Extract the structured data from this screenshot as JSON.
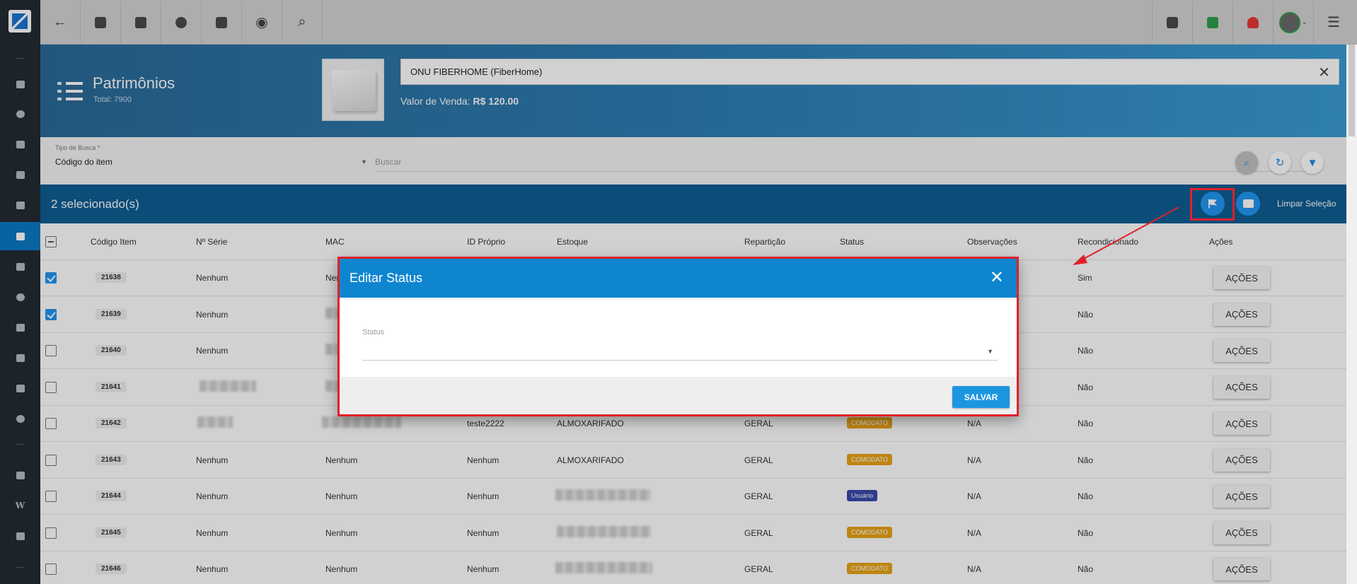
{
  "sidebar": {
    "icons": [
      "dashboard-icon",
      "pie-chart-icon",
      "contact-card-icon",
      "board-icon",
      "calendar-icon",
      "box-icon",
      "money-icon",
      "location-icon",
      "list-icon",
      "server-icon",
      "document-icon",
      "gear-icon",
      "youtube-icon",
      "wordpress-icon",
      "chat-icon"
    ],
    "wordpress_glyph": "W"
  },
  "topbar": {
    "left_icons": [
      "back-arrow-icon",
      "contact-icon",
      "calendar-clock-icon",
      "dollar-icon",
      "terminal-icon",
      "eye-icon",
      "search-icon"
    ],
    "right_icons": [
      "pdf-icon",
      "chat-check-icon",
      "alarm-icon",
      "avatar",
      "menu-list-icon"
    ],
    "back_glyph": "←",
    "eye_glyph": "◉",
    "search_glyph": "⌕",
    "menu_glyph": "☰",
    "avatar_caret": "⌄"
  },
  "header": {
    "title": "Patrimônios",
    "total": "Total: 7900",
    "product": "ONU FIBERHOME  (FiberHome)",
    "close_glyph": "✕",
    "price_label": "Valor de Venda: ",
    "price_value": "R$ 120.00"
  },
  "search": {
    "type_label": "Tipo de Busca *",
    "type_value": "Código do item",
    "caret": "▼",
    "placeholder": "Buscar",
    "search_glyph": "⌕",
    "refresh_glyph": "↻",
    "filter_glyph": "▼"
  },
  "selection": {
    "text": "2 selecionado(s)",
    "clear": "Limpar Seleção"
  },
  "columns": [
    "Código Item",
    "Nº Série",
    "MAC",
    "ID Próprio",
    "Estoque",
    "Repartição",
    "Status",
    "Observações",
    "Recondicionado",
    "Ações"
  ],
  "rows": [
    {
      "checked": true,
      "code": "21638",
      "serie": "Nenhum",
      "mac": "Nenhum",
      "id": "",
      "estoque": "",
      "reparticao": "",
      "status": "",
      "obs": "",
      "recond": "Sim",
      "acoes": "AÇÕES"
    },
    {
      "checked": true,
      "code": "21639",
      "serie": "Nenhum",
      "mac": "",
      "id": "",
      "estoque": "",
      "reparticao": "",
      "status": "",
      "obs": "",
      "recond": "Não",
      "acoes": "AÇÕES"
    },
    {
      "checked": false,
      "code": "21640",
      "serie": "Nenhum",
      "mac": "",
      "id": "",
      "estoque": "",
      "reparticao": "",
      "status": "",
      "obs": "",
      "recond": "Não",
      "acoes": "AÇÕES"
    },
    {
      "checked": false,
      "code": "21641",
      "serie": "",
      "mac": "",
      "id": "",
      "estoque": "",
      "reparticao": "",
      "status": "",
      "obs": "",
      "recond": "Não",
      "acoes": "AÇÕES"
    },
    {
      "checked": false,
      "code": "21642",
      "serie": "",
      "mac": "",
      "id": "teste2222",
      "estoque": "ALMOXARIFADO",
      "reparticao": "GERAL",
      "status": "COMODATO",
      "obs": "N/A",
      "recond": "Não",
      "acoes": "AÇÕES"
    },
    {
      "checked": false,
      "code": "21643",
      "serie": "Nenhum",
      "mac": "Nenhum",
      "id": "Nenhum",
      "estoque": "ALMOXARIFADO",
      "reparticao": "GERAL",
      "status": "COMODATO",
      "obs": "N/A",
      "recond": "Não",
      "acoes": "AÇÕES"
    },
    {
      "checked": false,
      "code": "21644",
      "serie": "Nenhum",
      "mac": "Nenhum",
      "id": "Nenhum",
      "estoque": "",
      "reparticao": "GERAL",
      "status": "Usuário",
      "obs": "N/A",
      "recond": "Não",
      "acoes": "AÇÕES"
    },
    {
      "checked": false,
      "code": "21645",
      "serie": "Nenhum",
      "mac": "Nenhum",
      "id": "Nenhum",
      "estoque": "",
      "reparticao": "GERAL",
      "status": "COMODATO",
      "obs": "N/A",
      "recond": "Não",
      "acoes": "AÇÕES"
    },
    {
      "checked": false,
      "code": "21646",
      "serie": "Nenhum",
      "mac": "Nenhum",
      "id": "Nenhum",
      "estoque": "",
      "reparticao": "GERAL",
      "status": "COMODATO",
      "obs": "N/A",
      "recond": "Não",
      "acoes": "AÇÕES"
    }
  ],
  "dialog": {
    "title": "Editar Status",
    "close_glyph": "✕",
    "field_label": "Status",
    "field_value": "",
    "caret": "▼",
    "save": "SALVAR"
  },
  "colors": {
    "rail": "#232b33",
    "accent": "#0f85d0",
    "selection_bar": "#0e5d93",
    "annotation_red": "#e0202a",
    "comodato": "#e8a317",
    "usuario": "#3949ab"
  }
}
